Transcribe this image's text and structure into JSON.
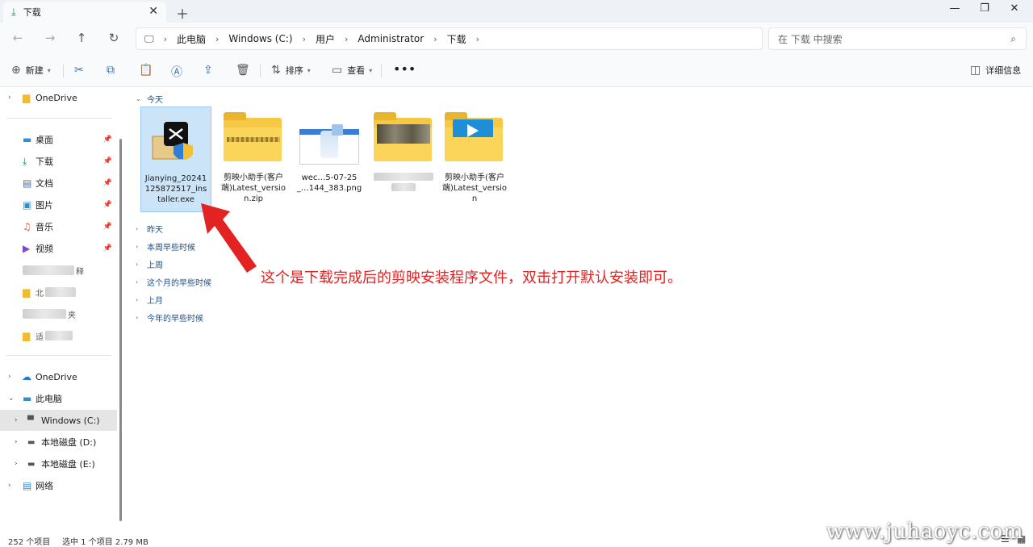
{
  "tab": {
    "title": "下载"
  },
  "address": {
    "crumbs": [
      "此电脑",
      "Windows (C:)",
      "用户",
      "Administrator",
      "下载"
    ]
  },
  "search": {
    "placeholder": "在 下载 中搜索"
  },
  "toolbar": {
    "new_label": "新建",
    "sort_label": "排序",
    "view_label": "查看",
    "details_label": "详细信息"
  },
  "sidebar": {
    "onedrive_top": "OneDrive",
    "quick": [
      "桌面",
      "下载",
      "文档",
      "图片",
      "音乐",
      "视频"
    ],
    "blurred_fragments": [
      "释",
      "北",
      "夹",
      "适"
    ],
    "onedrive": "OneDrive",
    "this_pc": "此电脑",
    "drives": [
      "Windows (C:)",
      "本地磁盘 (D:)",
      "本地磁盘 (E:)"
    ],
    "network": "网络"
  },
  "groups": {
    "today": "今天",
    "yesterday": "昨天",
    "this_week": "本周早些时候",
    "last_week": "上周",
    "this_month": "这个月的早些时候",
    "last_month": "上月",
    "this_year": "今年的早些时候"
  },
  "files": [
    {
      "name": "Jianying_20241125872517_installer.exe",
      "icon": "capcut-installer-icon"
    },
    {
      "name": "剪映小助手(客户端)Latest_version.zip",
      "icon": "zip-folder-icon"
    },
    {
      "name": "wec…5-07-25_…144_383.png",
      "icon": "image-thumbnail-icon"
    },
    {
      "name": "",
      "icon": "blurred-folder-icon"
    },
    {
      "name": "剪映小助手(客户端)Latest_version",
      "icon": "video-folder-icon"
    }
  ],
  "annotation": "这个是下载完成后的剪映安装程序文件，双击打开默认安装即可。",
  "status": {
    "items": "252 个项目",
    "selected": "选中 1 个项目  2.79 MB"
  },
  "watermark": "www.juhaoyc.com",
  "colors": {
    "accent": "#0067c0",
    "annotation": "#e32222",
    "folder": "#f7c843"
  }
}
